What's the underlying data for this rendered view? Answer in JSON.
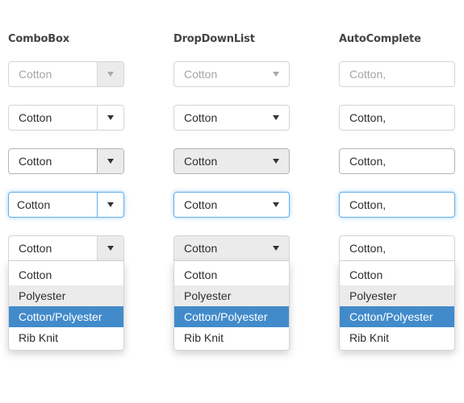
{
  "columns": {
    "combobox": {
      "title": "ComboBox",
      "states": {
        "disabled": {
          "value": "Cotton"
        },
        "normal": {
          "value": "Cotton"
        },
        "hover": {
          "value": "Cotton"
        },
        "focus": {
          "value": "Cotton"
        },
        "open": {
          "value": "Cotton"
        }
      }
    },
    "dropdownlist": {
      "title": "DropDownList",
      "states": {
        "disabled": {
          "value": "Cotton"
        },
        "normal": {
          "value": "Cotton"
        },
        "hover": {
          "value": "Cotton"
        },
        "focus": {
          "value": "Cotton"
        },
        "open": {
          "value": "Cotton"
        }
      }
    },
    "autocomplete": {
      "title": "AutoComplete",
      "states": {
        "disabled": {
          "value": "Cotton,"
        },
        "normal": {
          "value": "Cotton,"
        },
        "hover": {
          "value": "Cotton,"
        },
        "focus": {
          "value": "Cotton,"
        },
        "open": {
          "value": "Cotton,"
        }
      }
    }
  },
  "options": [
    "Cotton",
    "Polyester",
    "Cotton/Polyester",
    "Rib Knit"
  ],
  "hovered_option": "Polyester",
  "selected_option": "Cotton/Polyester",
  "colors": {
    "accent": "#428bca",
    "focus_border": "#66afe9",
    "hover_bg": "#ebebeb"
  }
}
